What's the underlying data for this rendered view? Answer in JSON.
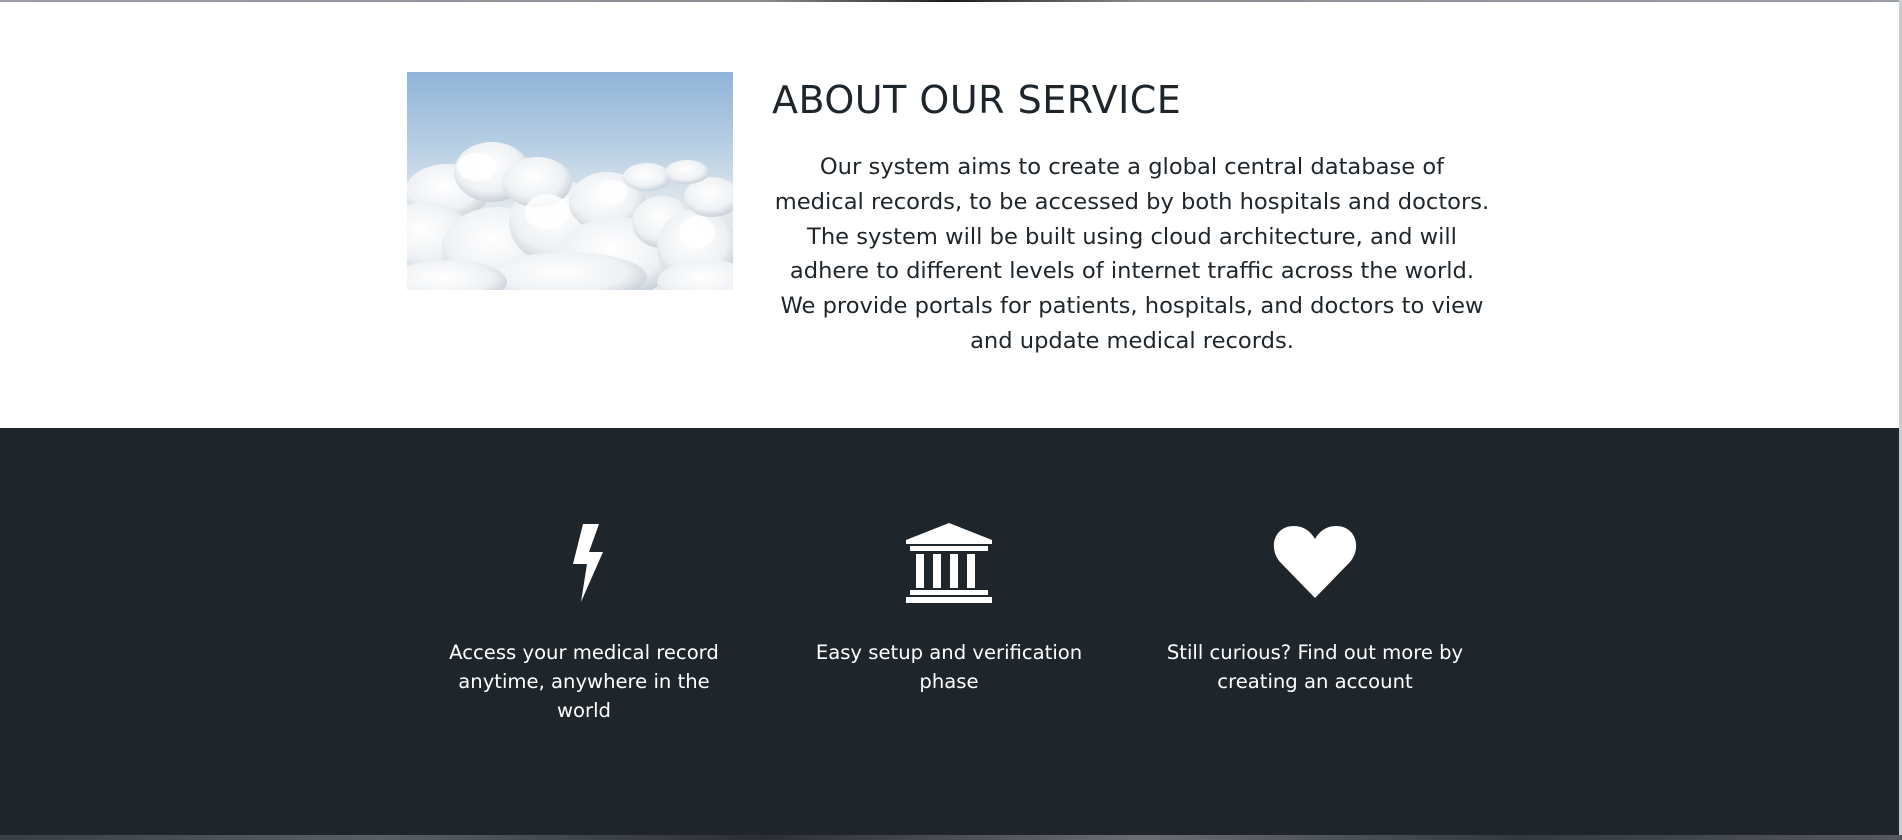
{
  "about": {
    "title": "ABOUT OUR SERVICE",
    "description": "Our system aims to create a global central database of medical records, to be accessed by both hospitals and doctors. The system will be built using cloud architecture, and will adhere to different levels of internet traffic across the world. We provide portals for patients, hospitals, and doctors to view and update medical records.",
    "image_icon": "clouds-photo"
  },
  "features": {
    "items": [
      {
        "icon": "lightning-bolt-icon",
        "text": "Access your medical record anytime, anywhere in the world"
      },
      {
        "icon": "bank-building-icon",
        "text": "Easy setup and verification phase"
      },
      {
        "icon": "heart-icon",
        "text": "Still curious? Find out more by creating an account"
      }
    ]
  },
  "colors": {
    "dark_section": "#1f262b",
    "text_dark": "#1f262b",
    "text_light": "#ffffff",
    "background": "#ffffff"
  }
}
